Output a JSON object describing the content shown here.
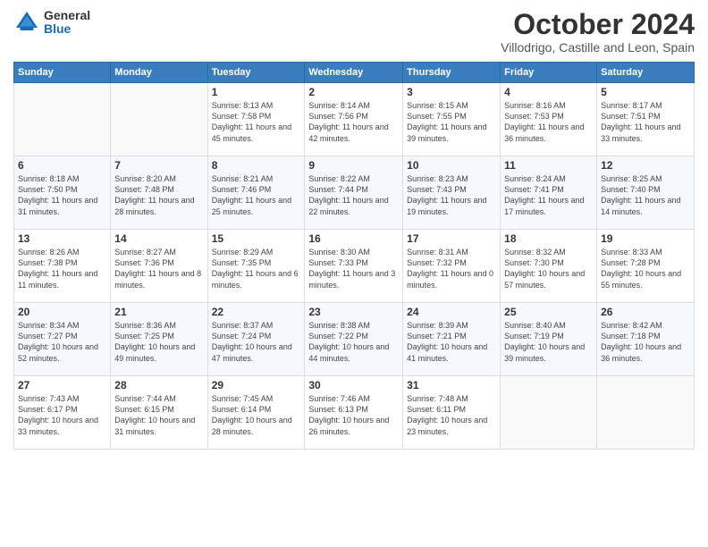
{
  "logo": {
    "general": "General",
    "blue": "Blue"
  },
  "title": "October 2024",
  "location": "Villodrigo, Castille and Leon, Spain",
  "weekdays": [
    "Sunday",
    "Monday",
    "Tuesday",
    "Wednesday",
    "Thursday",
    "Friday",
    "Saturday"
  ],
  "weeks": [
    [
      {
        "day": "",
        "info": ""
      },
      {
        "day": "",
        "info": ""
      },
      {
        "day": "1",
        "info": "Sunrise: 8:13 AM\nSunset: 7:58 PM\nDaylight: 11 hours and 45 minutes."
      },
      {
        "day": "2",
        "info": "Sunrise: 8:14 AM\nSunset: 7:56 PM\nDaylight: 11 hours and 42 minutes."
      },
      {
        "day": "3",
        "info": "Sunrise: 8:15 AM\nSunset: 7:55 PM\nDaylight: 11 hours and 39 minutes."
      },
      {
        "day": "4",
        "info": "Sunrise: 8:16 AM\nSunset: 7:53 PM\nDaylight: 11 hours and 36 minutes."
      },
      {
        "day": "5",
        "info": "Sunrise: 8:17 AM\nSunset: 7:51 PM\nDaylight: 11 hours and 33 minutes."
      }
    ],
    [
      {
        "day": "6",
        "info": "Sunrise: 8:18 AM\nSunset: 7:50 PM\nDaylight: 11 hours and 31 minutes."
      },
      {
        "day": "7",
        "info": "Sunrise: 8:20 AM\nSunset: 7:48 PM\nDaylight: 11 hours and 28 minutes."
      },
      {
        "day": "8",
        "info": "Sunrise: 8:21 AM\nSunset: 7:46 PM\nDaylight: 11 hours and 25 minutes."
      },
      {
        "day": "9",
        "info": "Sunrise: 8:22 AM\nSunset: 7:44 PM\nDaylight: 11 hours and 22 minutes."
      },
      {
        "day": "10",
        "info": "Sunrise: 8:23 AM\nSunset: 7:43 PM\nDaylight: 11 hours and 19 minutes."
      },
      {
        "day": "11",
        "info": "Sunrise: 8:24 AM\nSunset: 7:41 PM\nDaylight: 11 hours and 17 minutes."
      },
      {
        "day": "12",
        "info": "Sunrise: 8:25 AM\nSunset: 7:40 PM\nDaylight: 11 hours and 14 minutes."
      }
    ],
    [
      {
        "day": "13",
        "info": "Sunrise: 8:26 AM\nSunset: 7:38 PM\nDaylight: 11 hours and 11 minutes."
      },
      {
        "day": "14",
        "info": "Sunrise: 8:27 AM\nSunset: 7:36 PM\nDaylight: 11 hours and 8 minutes."
      },
      {
        "day": "15",
        "info": "Sunrise: 8:29 AM\nSunset: 7:35 PM\nDaylight: 11 hours and 6 minutes."
      },
      {
        "day": "16",
        "info": "Sunrise: 8:30 AM\nSunset: 7:33 PM\nDaylight: 11 hours and 3 minutes."
      },
      {
        "day": "17",
        "info": "Sunrise: 8:31 AM\nSunset: 7:32 PM\nDaylight: 11 hours and 0 minutes."
      },
      {
        "day": "18",
        "info": "Sunrise: 8:32 AM\nSunset: 7:30 PM\nDaylight: 10 hours and 57 minutes."
      },
      {
        "day": "19",
        "info": "Sunrise: 8:33 AM\nSunset: 7:28 PM\nDaylight: 10 hours and 55 minutes."
      }
    ],
    [
      {
        "day": "20",
        "info": "Sunrise: 8:34 AM\nSunset: 7:27 PM\nDaylight: 10 hours and 52 minutes."
      },
      {
        "day": "21",
        "info": "Sunrise: 8:36 AM\nSunset: 7:25 PM\nDaylight: 10 hours and 49 minutes."
      },
      {
        "day": "22",
        "info": "Sunrise: 8:37 AM\nSunset: 7:24 PM\nDaylight: 10 hours and 47 minutes."
      },
      {
        "day": "23",
        "info": "Sunrise: 8:38 AM\nSunset: 7:22 PM\nDaylight: 10 hours and 44 minutes."
      },
      {
        "day": "24",
        "info": "Sunrise: 8:39 AM\nSunset: 7:21 PM\nDaylight: 10 hours and 41 minutes."
      },
      {
        "day": "25",
        "info": "Sunrise: 8:40 AM\nSunset: 7:19 PM\nDaylight: 10 hours and 39 minutes."
      },
      {
        "day": "26",
        "info": "Sunrise: 8:42 AM\nSunset: 7:18 PM\nDaylight: 10 hours and 36 minutes."
      }
    ],
    [
      {
        "day": "27",
        "info": "Sunrise: 7:43 AM\nSunset: 6:17 PM\nDaylight: 10 hours and 33 minutes."
      },
      {
        "day": "28",
        "info": "Sunrise: 7:44 AM\nSunset: 6:15 PM\nDaylight: 10 hours and 31 minutes."
      },
      {
        "day": "29",
        "info": "Sunrise: 7:45 AM\nSunset: 6:14 PM\nDaylight: 10 hours and 28 minutes."
      },
      {
        "day": "30",
        "info": "Sunrise: 7:46 AM\nSunset: 6:13 PM\nDaylight: 10 hours and 26 minutes."
      },
      {
        "day": "31",
        "info": "Sunrise: 7:48 AM\nSunset: 6:11 PM\nDaylight: 10 hours and 23 minutes."
      },
      {
        "day": "",
        "info": ""
      },
      {
        "day": "",
        "info": ""
      }
    ]
  ]
}
